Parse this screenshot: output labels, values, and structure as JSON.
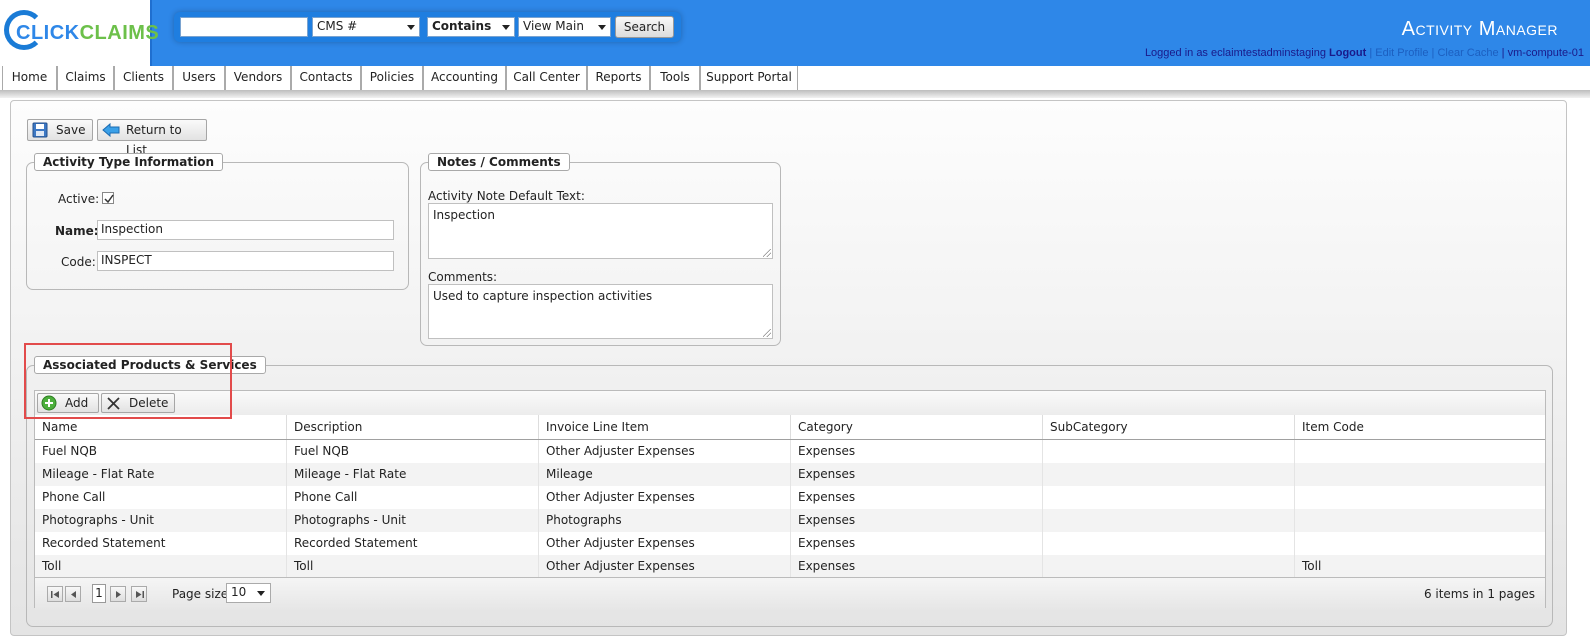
{
  "logo": {
    "part_a": "CLICK",
    "part_b": "CLAIMS"
  },
  "search": {
    "query_value": "",
    "field_select": "CMS #",
    "match_select": "Contains",
    "view_select": "View Main",
    "search_label": "Search"
  },
  "app_title": "Activity Manager",
  "user": {
    "logged_in_prefix": "Logged in as",
    "username": "eclaimtestadminstaging",
    "logout": "Logout",
    "edit_profile": "Edit Profile",
    "clear_cache": "Clear Cache",
    "server": "vm-compute-01"
  },
  "nav": [
    "Home",
    "Claims",
    "Clients",
    "Users",
    "Vendors",
    "Contacts",
    "Policies",
    "Accounting",
    "Call Center",
    "Reports",
    "Tools",
    "Support Portal"
  ],
  "toolbar": {
    "save_label": "Save",
    "return_label": "Return to List"
  },
  "activity_type": {
    "legend": "Activity Type Information",
    "active_label": "Active:",
    "active_checked": true,
    "name_label": "Name:",
    "name_value": "Inspection",
    "code_label": "Code:",
    "code_value": "INSPECT"
  },
  "notes": {
    "legend": "Notes / Comments",
    "default_text_label": "Activity Note Default Text:",
    "default_text_value": "Inspection",
    "comments_label": "Comments:",
    "comments_value": "Used to capture inspection activities"
  },
  "products": {
    "legend": "Associated Products & Services",
    "add_label": "Add",
    "delete_label": "Delete",
    "columns": [
      "Name",
      "Description",
      "Invoice Line Item",
      "Category",
      "SubCategory",
      "Item Code"
    ],
    "rows": [
      [
        "Fuel NQB",
        "Fuel NQB",
        "Other Adjuster Expenses",
        "Expenses",
        "",
        ""
      ],
      [
        "Mileage - Flat Rate",
        "Mileage - Flat Rate",
        "Mileage",
        "Expenses",
        "",
        ""
      ],
      [
        "Phone Call",
        "Phone Call",
        "Other Adjuster Expenses",
        "Expenses",
        "",
        ""
      ],
      [
        "Photographs - Unit",
        "Photographs - Unit",
        "Photographs",
        "Expenses",
        "",
        ""
      ],
      [
        "Recorded Statement",
        "Recorded Statement",
        "Other Adjuster Expenses",
        "Expenses",
        "",
        ""
      ],
      [
        "Toll",
        "Toll",
        "Other Adjuster Expenses",
        "Expenses",
        "",
        "Toll"
      ]
    ],
    "pager": {
      "current_page": "1",
      "page_size_label": "Page size:",
      "page_size_value": "10",
      "summary": "6 items in 1 pages"
    }
  },
  "colors": {
    "header_blue": "#2e87e8",
    "logo_green": "#6cc04a",
    "highlight_red": "#e24b4b"
  }
}
